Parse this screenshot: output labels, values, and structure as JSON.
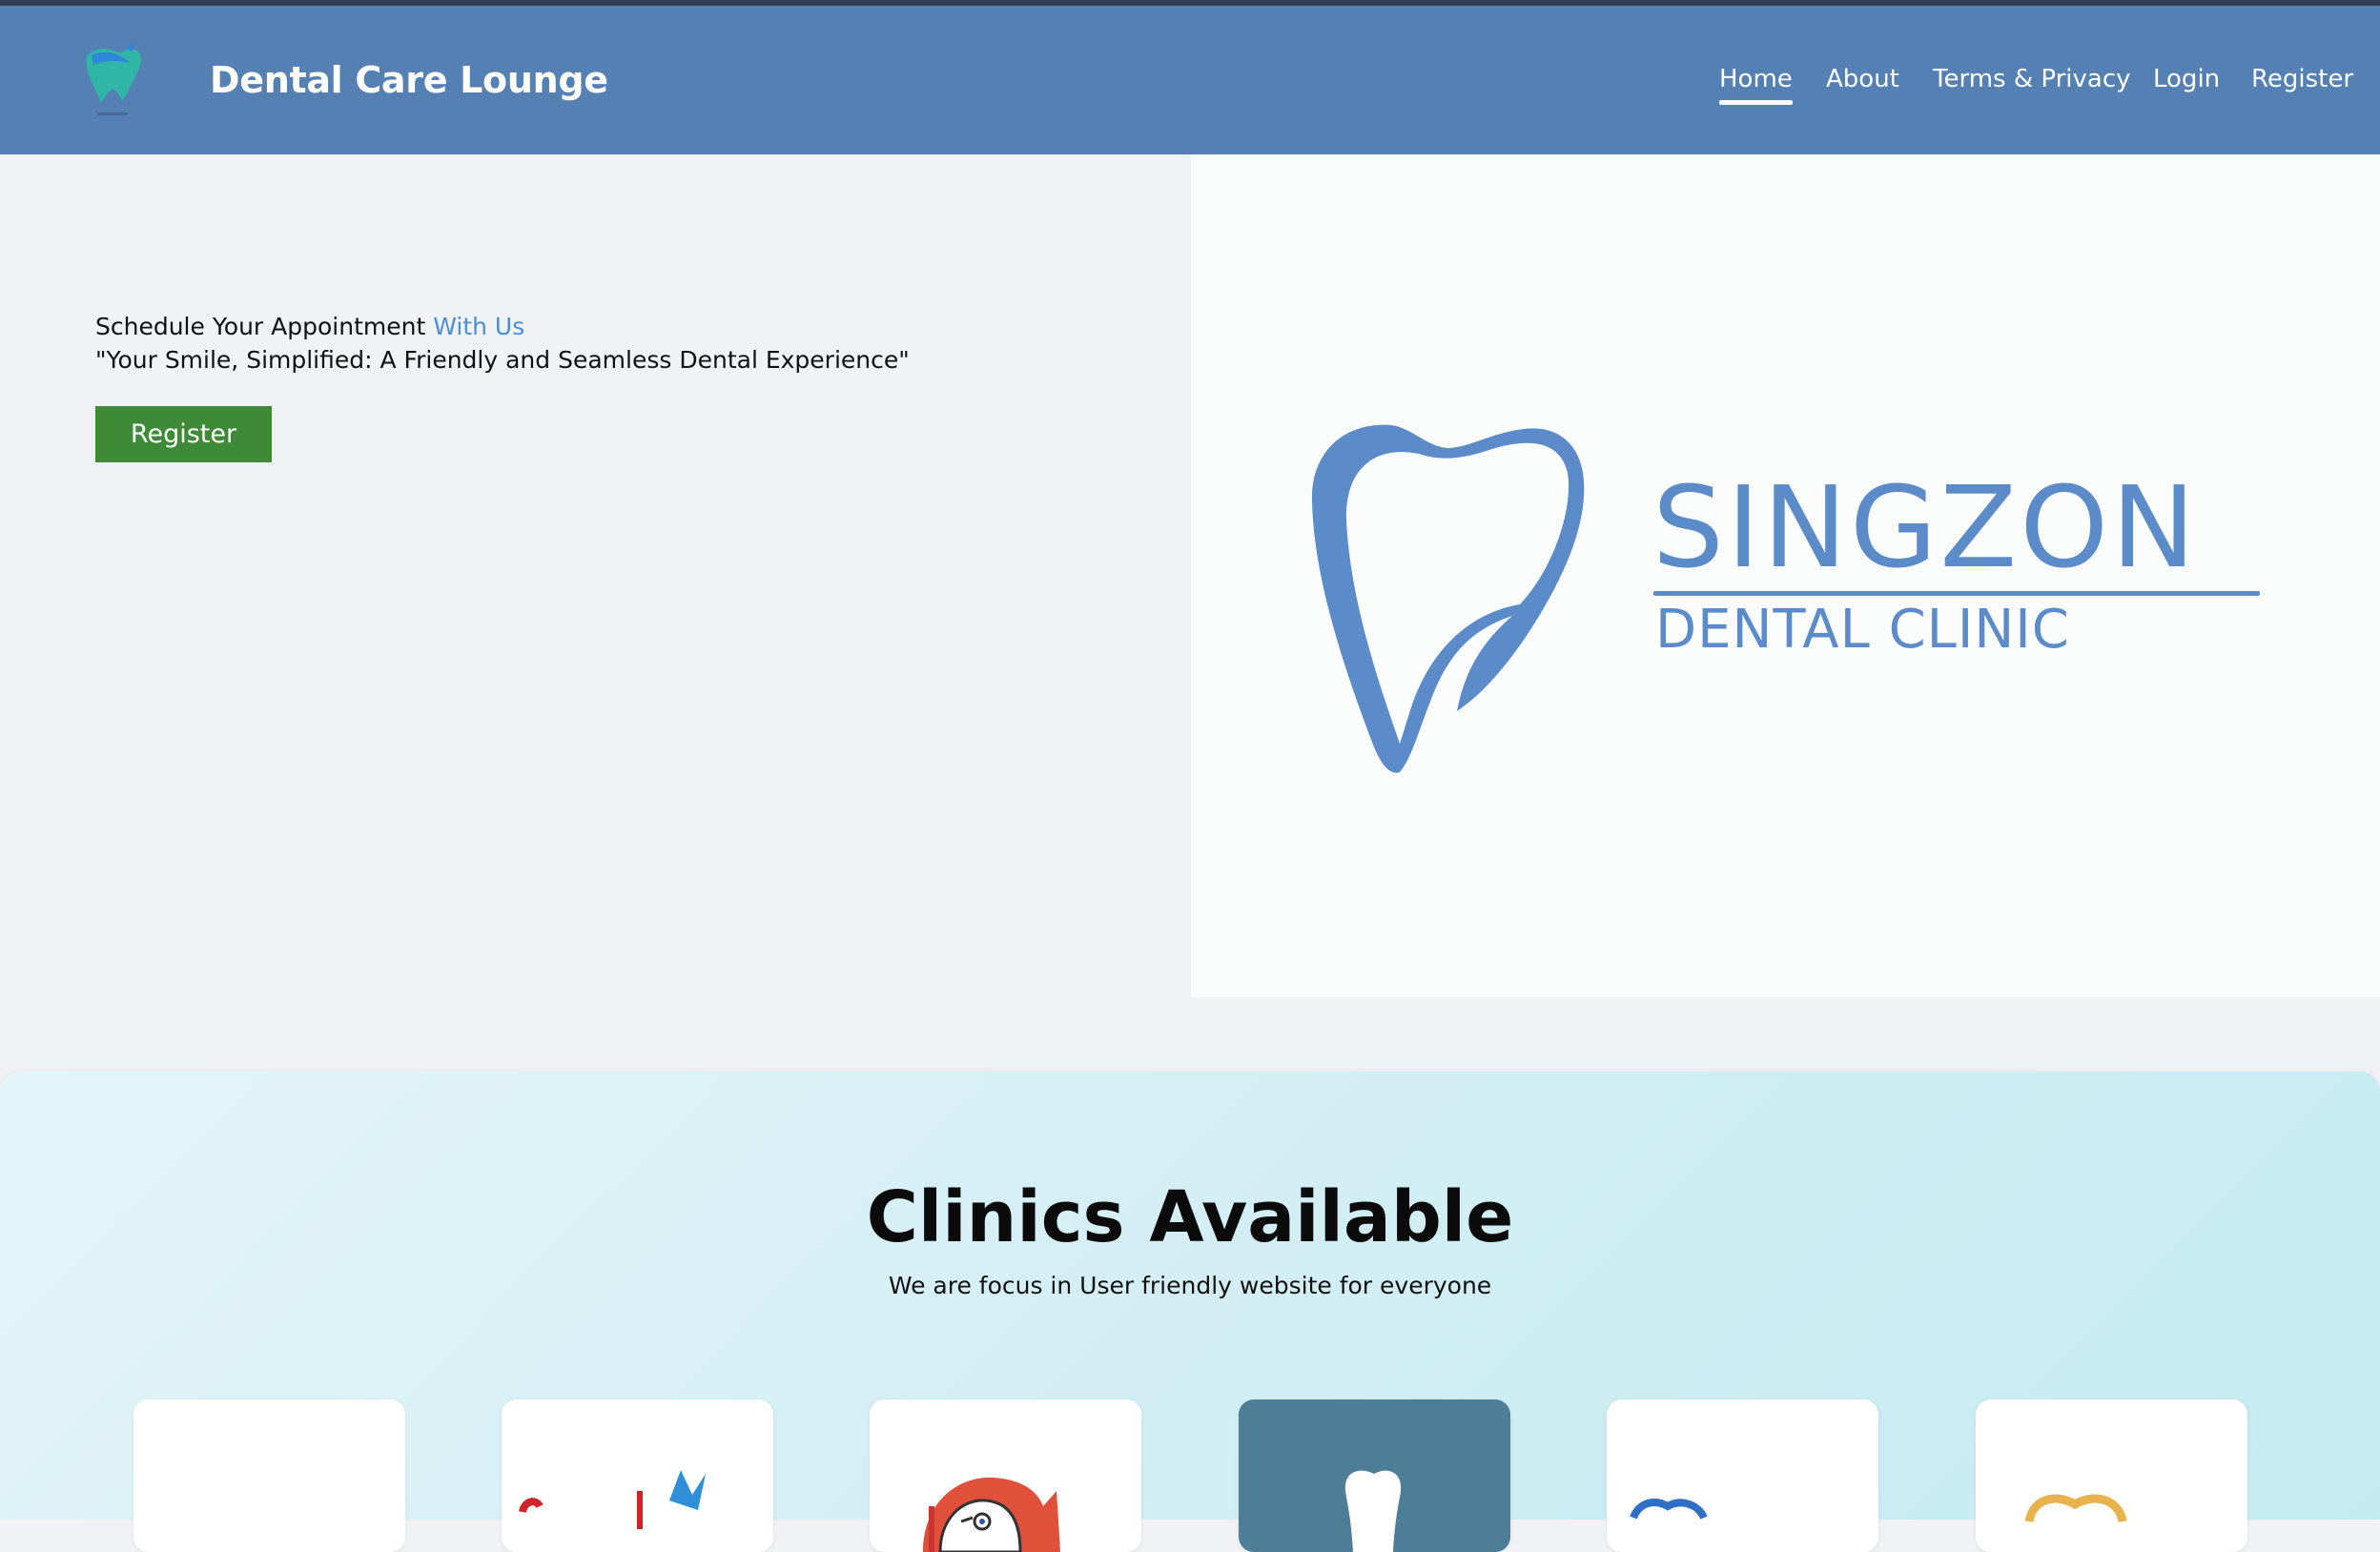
{
  "header": {
    "title": "Dental Care Lounge",
    "nav": [
      {
        "label": "Home",
        "active": true
      },
      {
        "label": "About",
        "active": false
      },
      {
        "label": "Terms & Privacy",
        "active": false
      },
      {
        "label": "Login",
        "active": false
      },
      {
        "label": "Register",
        "active": false
      }
    ]
  },
  "hero": {
    "tagline_main": "Schedule Your Appointment ",
    "tagline_accent": "With Us",
    "quote": "\"Your Smile, Simplified: A Friendly and Seamless Dental Experience\"",
    "register_label": "Register",
    "logo": {
      "name": "SINGZON",
      "sub": "DENTAL CLINIC"
    }
  },
  "clinics": {
    "title": "Clinics Available",
    "subtitle": "We are focus in User friendly website for everyone"
  },
  "colors": {
    "navbar": "#5480b4",
    "accent": "#4a8fdc",
    "register_button": "#3e8a37",
    "logo_blue": "#5b8bc8"
  }
}
